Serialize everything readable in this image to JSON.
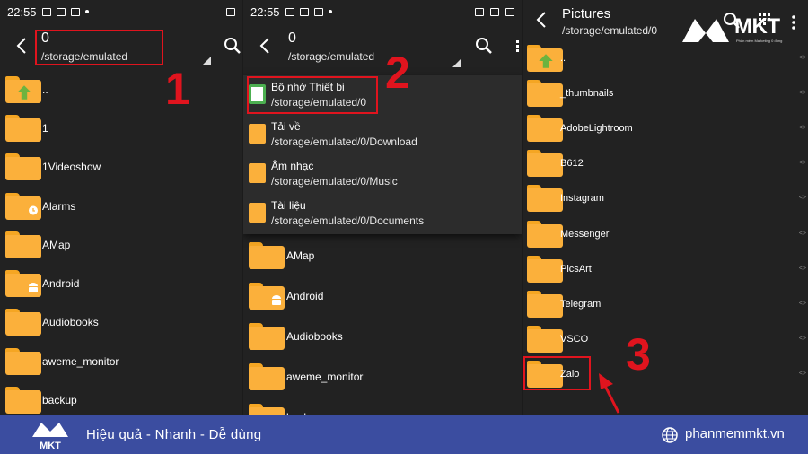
{
  "panel1": {
    "status": {
      "time": "22:55"
    },
    "title": "0",
    "path": "/storage/emulated",
    "items": [
      {
        "label": "..",
        "kind": "up"
      },
      {
        "label": "1",
        "kind": "folder"
      },
      {
        "label": "1Videoshow",
        "kind": "folder"
      },
      {
        "label": "Alarms",
        "kind": "alarm"
      },
      {
        "label": "AMap",
        "kind": "folder"
      },
      {
        "label": "Android",
        "kind": "android"
      },
      {
        "label": "Audiobooks",
        "kind": "folder"
      },
      {
        "label": "aweme_monitor",
        "kind": "folder"
      },
      {
        "label": "backup",
        "kind": "folder"
      }
    ],
    "step": "1"
  },
  "panel2": {
    "status": {
      "time": "22:55"
    },
    "title": "0",
    "path": "/storage/emulated",
    "step": "2",
    "dropdown": [
      {
        "label": "Bộ nhớ Thiết bị",
        "path": "/storage/emulated/0",
        "icon": "device-storage-icon"
      },
      {
        "label": "Tải về",
        "path": "/storage/emulated/0/Download",
        "icon": "download-folder-icon"
      },
      {
        "label": "Âm nhạc",
        "path": "/storage/emulated/0/Music",
        "icon": "music-folder-icon"
      },
      {
        "label": "Tài liệu",
        "path": "/storage/emulated/0/Documents",
        "icon": "documents-folder-icon"
      }
    ],
    "items": [
      {
        "label": "AMap",
        "kind": "folder"
      },
      {
        "label": "Android",
        "kind": "android"
      },
      {
        "label": "Audiobooks",
        "kind": "folder"
      },
      {
        "label": "aweme_monitor",
        "kind": "folder"
      },
      {
        "label": "backup",
        "kind": "folder"
      }
    ]
  },
  "panel3": {
    "title": "Pictures",
    "path": "/storage/emulated/0",
    "step": "3",
    "items": [
      {
        "label": "..",
        "kind": "up"
      },
      {
        "label": "_thumbnails",
        "kind": "folder"
      },
      {
        "label": "AdobeLightroom",
        "kind": "folder"
      },
      {
        "label": "B612",
        "kind": "folder"
      },
      {
        "label": "Instagram",
        "kind": "folder"
      },
      {
        "label": "Messenger",
        "kind": "folder"
      },
      {
        "label": "PicsArt",
        "kind": "folder"
      },
      {
        "label": "Telegram",
        "kind": "folder"
      },
      {
        "label": "VSCO",
        "kind": "folder"
      },
      {
        "label": "Zalo",
        "kind": "folder"
      }
    ]
  },
  "branding": {
    "logo_text": "MKT",
    "logo_sub": "Phần mềm Marketing 0 đồng",
    "tagline": "Hiệu quả - Nhanh - Dễ dùng",
    "website": "phanmemmkt.vn",
    "footer_bg": "#3b4da0"
  },
  "colors": {
    "folder": "#fbb03b",
    "highlight": "#e0141e",
    "panel_bg": "#222222"
  }
}
